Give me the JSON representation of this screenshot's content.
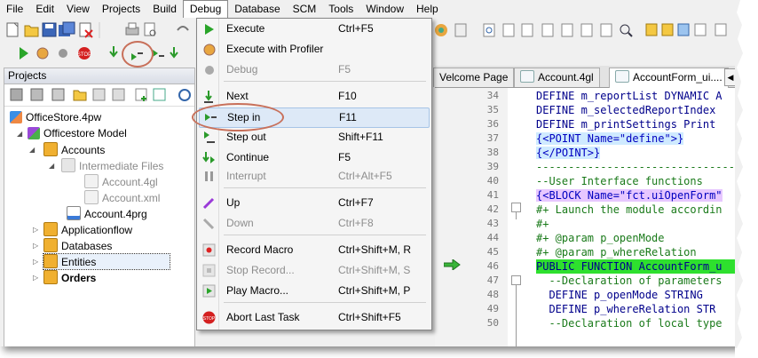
{
  "menubar": [
    "File",
    "Edit",
    "View",
    "Projects",
    "Build",
    "Debug",
    "Database",
    "SCM",
    "Tools",
    "Window",
    "Help"
  ],
  "active_menu": "Debug",
  "projects_panel": {
    "title": "Projects",
    "tree": [
      {
        "label": "OfficeStore.4pw",
        "style": "normal"
      },
      {
        "label": "Officestore Model",
        "style": "normal"
      },
      {
        "label": "Accounts",
        "style": "normal"
      },
      {
        "label": "Intermediate Files",
        "style": "gray"
      },
      {
        "label": "Account.4gl",
        "style": "gray"
      },
      {
        "label": "Account.xml",
        "style": "gray"
      },
      {
        "label": "Account.4prg",
        "style": "normal"
      },
      {
        "label": "Applicationflow",
        "style": "normal"
      },
      {
        "label": "Databases",
        "style": "normal"
      },
      {
        "label": "Entities",
        "style": "selected"
      },
      {
        "label": "Orders",
        "style": "bold"
      }
    ]
  },
  "debug_menu": [
    {
      "label": "Execute",
      "shortcut": "Ctrl+F5",
      "enabled": true,
      "icon": "play-icon"
    },
    {
      "label": "Execute with Profiler",
      "shortcut": "",
      "enabled": true,
      "icon": "profiler-icon"
    },
    {
      "label": "Debug",
      "shortcut": "F5",
      "enabled": false,
      "icon": "bug-icon"
    },
    {
      "label": "Next",
      "shortcut": "F10",
      "enabled": true,
      "icon": "step-over-icon"
    },
    {
      "label": "Step in",
      "shortcut": "F11",
      "enabled": true,
      "icon": "step-in-icon",
      "highlighted": true
    },
    {
      "label": "Step out",
      "shortcut": "Shift+F11",
      "enabled": true,
      "icon": "step-out-icon"
    },
    {
      "label": "Continue",
      "shortcut": "F5",
      "enabled": true,
      "icon": "continue-icon"
    },
    {
      "label": "Interrupt",
      "shortcut": "Ctrl+Alt+F5",
      "enabled": false,
      "icon": "pause-icon"
    },
    {
      "label": "Up",
      "shortcut": "Ctrl+F7",
      "enabled": true,
      "icon": "stack-up-icon"
    },
    {
      "label": "Down",
      "shortcut": "Ctrl+F8",
      "enabled": false,
      "icon": "stack-down-icon"
    },
    {
      "label": "Record Macro",
      "shortcut": "Ctrl+Shift+M, R",
      "enabled": true,
      "icon": "record-icon"
    },
    {
      "label": "Stop Record...",
      "shortcut": "Ctrl+Shift+M, S",
      "enabled": false,
      "icon": "stop-icon"
    },
    {
      "label": "Play Macro...",
      "shortcut": "Ctrl+Shift+M, P",
      "enabled": true,
      "icon": "play-macro-icon"
    },
    {
      "label": "Abort Last Task",
      "shortcut": "Ctrl+Shift+F5",
      "enabled": true,
      "icon": "abort-icon"
    }
  ],
  "editor": {
    "tabs": [
      {
        "label": "Velcome Page",
        "active": false
      },
      {
        "label": "Account.4gl",
        "active": false
      },
      {
        "label": "AccountForm_ui....",
        "active": true
      }
    ],
    "lines": [
      {
        "n": "34",
        "text": "DEFINE m_reportList DYNAMIC A",
        "kind": "kw"
      },
      {
        "n": "35",
        "text": "DEFINE m_selectedReportIndex",
        "kind": "kw"
      },
      {
        "n": "36",
        "text": "DEFINE m_printSettings Print",
        "kind": "kw"
      },
      {
        "n": "37",
        "text": "{<POINT Name=\"define\">}",
        "kind": "tag"
      },
      {
        "n": "38",
        "text": "{</POINT>}",
        "kind": "tag"
      },
      {
        "n": "39",
        "text": "---------------------------------",
        "kind": "cm"
      },
      {
        "n": "40",
        "text": "--User Interface functions",
        "kind": "cm"
      },
      {
        "n": "41",
        "text": "{<BLOCK Name=\"fct.uiOpenForm\"",
        "kind": "tagp"
      },
      {
        "n": "42",
        "text": "#+ Launch the module accordin",
        "kind": "cm"
      },
      {
        "n": "43",
        "text": "#+",
        "kind": "cm"
      },
      {
        "n": "44",
        "text": "#+ @param p_openMode",
        "kind": "cm"
      },
      {
        "n": "45",
        "text": "#+ @param p_whereRelation",
        "kind": "cm"
      },
      {
        "n": "46",
        "text": "PUBLIC FUNCTION AccountForm_u",
        "kind": "current"
      },
      {
        "n": "47",
        "text": "  --Declaration of parameters",
        "kind": "cm"
      },
      {
        "n": "48",
        "text": "  DEFINE p_openMode STRING",
        "kind": "kw"
      },
      {
        "n": "49",
        "text": "  DEFINE p_whereRelation STR",
        "kind": "kw"
      },
      {
        "n": "50",
        "text": "  --Declaration of local type",
        "kind": "cm"
      }
    ]
  }
}
